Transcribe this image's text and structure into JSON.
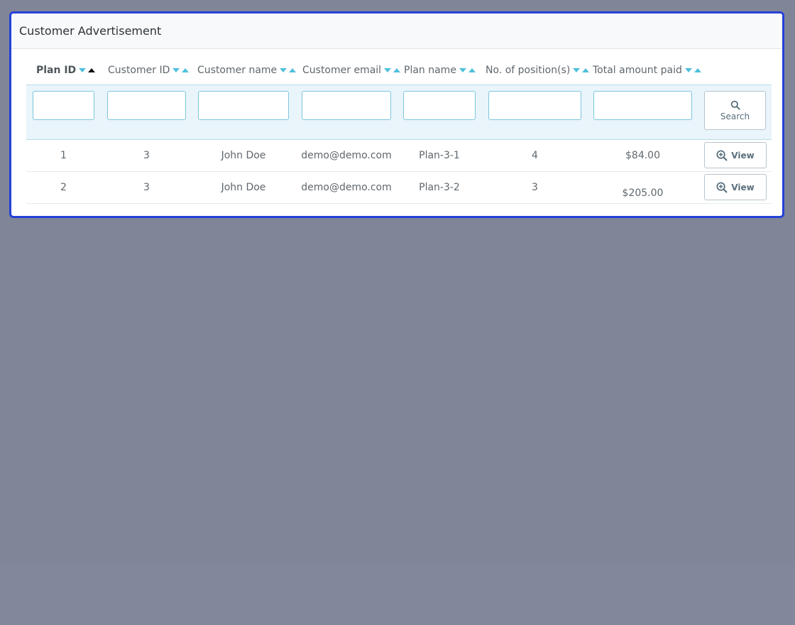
{
  "panel": {
    "title": "Customer Advertisement"
  },
  "columns": [
    {
      "label": "Plan ID",
      "active": true
    },
    {
      "label": "Customer ID",
      "active": false
    },
    {
      "label": "Customer name",
      "active": false
    },
    {
      "label": "Customer email",
      "active": false
    },
    {
      "label": "Plan name",
      "active": false
    },
    {
      "label": "No. of position(s)",
      "active": false
    },
    {
      "label": "Total amount paid",
      "active": false
    }
  ],
  "filters": {
    "plan_id": "",
    "customer_id": "",
    "customer_name": "",
    "customer_email": "",
    "plan_name": "",
    "positions": "",
    "amount": ""
  },
  "search_button": {
    "label": "Search",
    "icon": "search-icon"
  },
  "rows": [
    {
      "plan_id": "1",
      "customer_id": "3",
      "customer_name": "John Doe",
      "customer_email": "demo@demo.com",
      "plan_name": "Plan-3-1",
      "positions": "4",
      "amount": "$84.00",
      "action": "View"
    },
    {
      "plan_id": "2",
      "customer_id": "3",
      "customer_name": "John Doe",
      "customer_email": "demo@demo.com",
      "plan_name": "Plan-3-2",
      "positions": "3",
      "amount": "$205.00",
      "action": "View"
    }
  ],
  "colors": {
    "panel_border": "#2441d8",
    "backdrop": "#808598",
    "sort_arrow": "#4ec0dc",
    "filter_bg": "#eaf4fb"
  }
}
